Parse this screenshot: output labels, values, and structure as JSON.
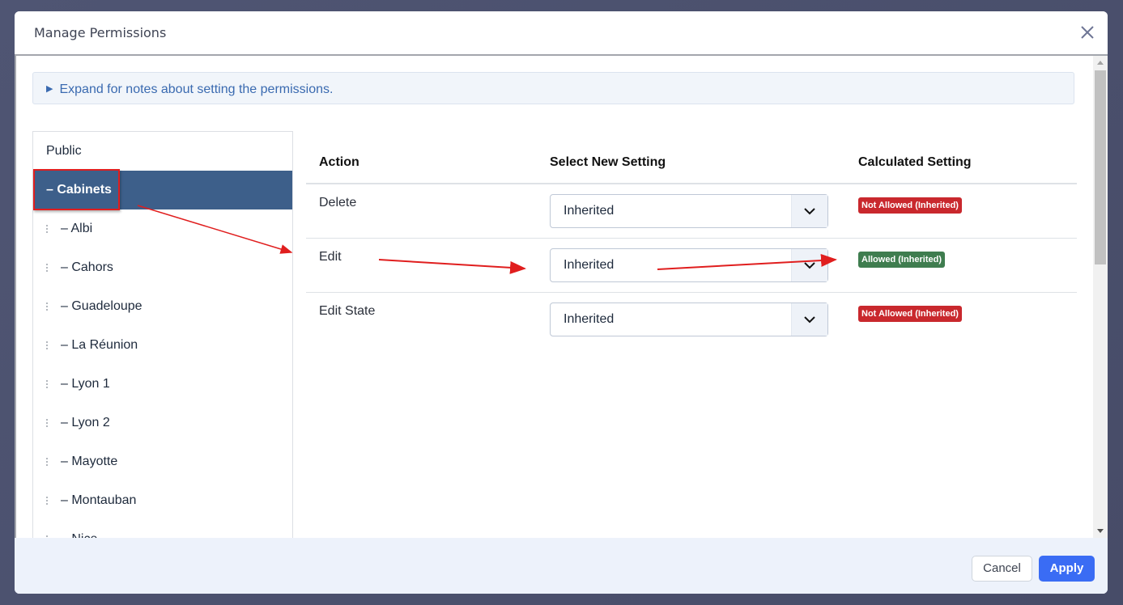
{
  "modal": {
    "title": "Manage Permissions",
    "close_icon": "close-icon"
  },
  "notes": {
    "icon": "triangle-right-icon",
    "text": "Expand for notes about setting the permissions."
  },
  "tree": {
    "root": "Public",
    "selected": "– Cabinets",
    "children": [
      "– Albi",
      "– Cahors",
      "– Guadeloupe",
      "– La Réunion",
      "– Lyon 1",
      "– Lyon 2",
      "– Mayotte",
      "– Montauban",
      "– Nice"
    ]
  },
  "table": {
    "headers": [
      "Action",
      "Select New Setting",
      "Calculated Setting"
    ],
    "rows": [
      {
        "action": "Delete",
        "setting": "Inherited",
        "calculated": "Not Allowed (Inherited)",
        "status_color": "#c9282d"
      },
      {
        "action": "Edit",
        "setting": "Inherited",
        "calculated": "Allowed (Inherited)",
        "status_color": "#3f7d4f"
      },
      {
        "action": "Edit State",
        "setting": "Inherited",
        "calculated": "Not Allowed (Inherited)",
        "status_color": "#c9282d"
      }
    ]
  },
  "footer": {
    "cancel_label": "Cancel",
    "apply_label": "Apply"
  },
  "colors": {
    "accent": "#3a6cf4",
    "selected_bg": "#3d5f8a",
    "annotation_red": "#e01e1e"
  }
}
